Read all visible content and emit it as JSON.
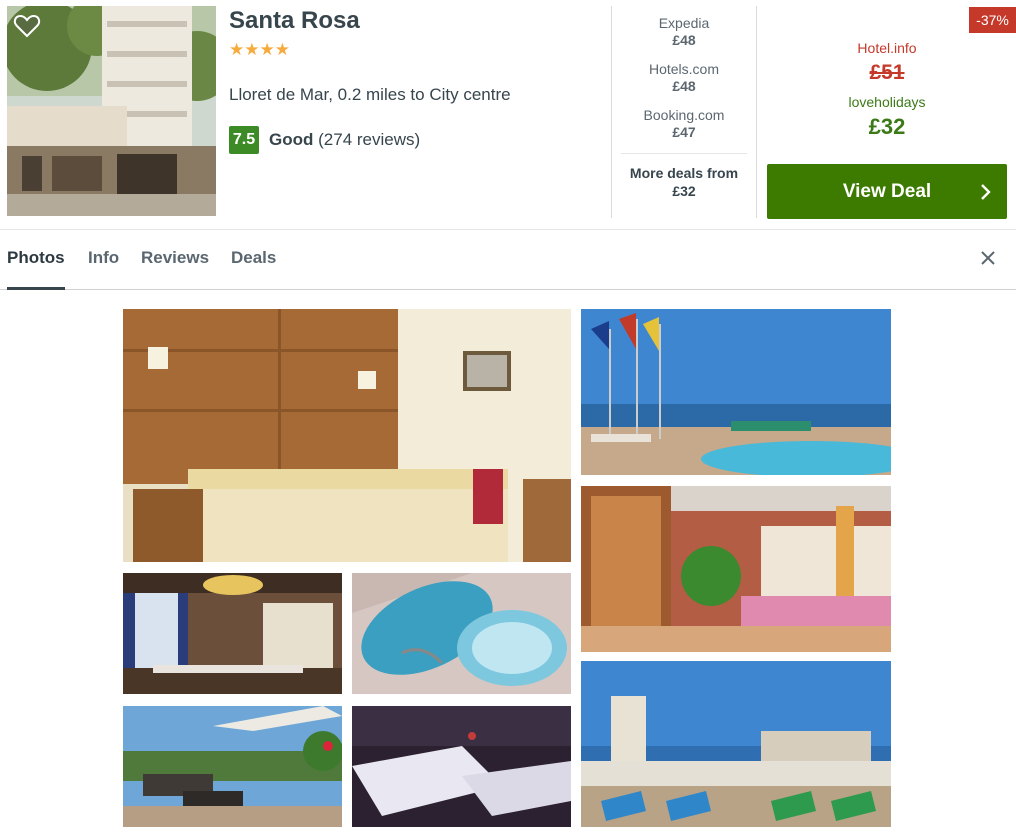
{
  "hotel": {
    "name": "Santa Rosa",
    "stars": "★★★★",
    "star_count": 4,
    "location": "Lloret de Mar, 0.2 miles to City centre",
    "score": "7.5",
    "rating_word": "Good",
    "reviews": "(274 reviews)"
  },
  "deals": [
    {
      "site": "Expedia",
      "price": "£48"
    },
    {
      "site": "Hotels.com",
      "price": "£48"
    },
    {
      "site": "Booking.com",
      "price": "£47"
    }
  ],
  "more_deals": {
    "label": "More deals from",
    "price": "£32"
  },
  "best_deal": {
    "discount": "-37%",
    "original_site": "Hotel.info",
    "original_price": "£51",
    "site": "loveholidays",
    "price": "£32",
    "button_label": "View Deal"
  },
  "tabs": [
    {
      "label": "Photos",
      "active": true
    },
    {
      "label": "Info",
      "active": false
    },
    {
      "label": "Reviews",
      "active": false
    },
    {
      "label": "Deals",
      "active": false
    }
  ],
  "icons": {
    "favorite": "heart-icon",
    "arrow": "chevron-right-icon",
    "close": "close-icon",
    "star": "star-icon"
  },
  "colors": {
    "score_bg": "#3d8b26",
    "button_bg": "#3c7b00",
    "discount_bg": "#c4392a",
    "best_price": "#3b7a17",
    "strike_price": "#c4392a",
    "star": "#f6ab3f"
  },
  "photos": [
    {
      "subject": "hotel-exterior"
    },
    {
      "subject": "bedroom"
    },
    {
      "subject": "rooftop-pool"
    },
    {
      "subject": "restaurant"
    },
    {
      "subject": "jacuzzi"
    },
    {
      "subject": "lobby"
    },
    {
      "subject": "terrace-lounge"
    },
    {
      "subject": "spa-beds"
    },
    {
      "subject": "sun-terrace"
    }
  ]
}
